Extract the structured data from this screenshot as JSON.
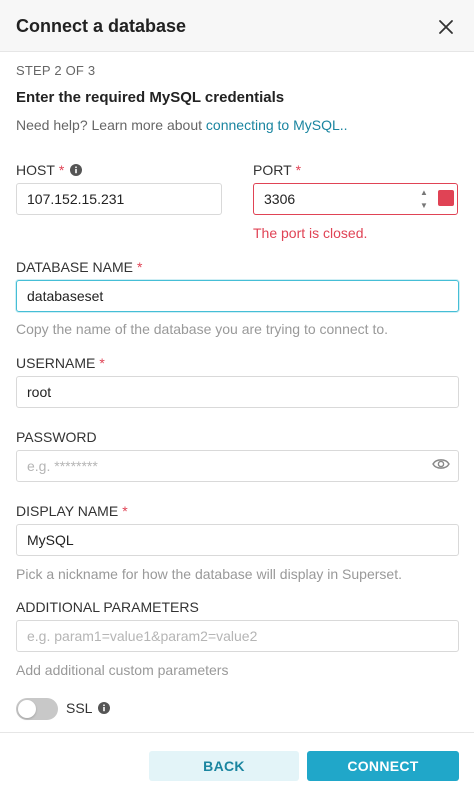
{
  "modal": {
    "title": "Connect a database",
    "step": "STEP 2 OF 3",
    "heading": "Enter the required MySQL credentials",
    "help_prefix": "Need help? Learn more about ",
    "help_link": "connecting to MySQL.."
  },
  "fields": {
    "host": {
      "label": "HOST",
      "required": "*",
      "value": "107.152.15.231"
    },
    "port": {
      "label": "PORT",
      "required": "*",
      "value": "3306",
      "error": "The port is closed."
    },
    "database_name": {
      "label": "DATABASE NAME",
      "required": "*",
      "value": "databaseset",
      "helper": "Copy the name of the database you are trying to connect to."
    },
    "username": {
      "label": "USERNAME",
      "required": "*",
      "value": "root"
    },
    "password": {
      "label": "PASSWORD",
      "placeholder": "e.g. ********"
    },
    "display_name": {
      "label": "DISPLAY NAME",
      "required": "*",
      "value": "MySQL",
      "helper": "Pick a nickname for how the database will display in Superset."
    },
    "additional_parameters": {
      "label": "ADDITIONAL PARAMETERS",
      "placeholder": "e.g. param1=value1&param2=value2",
      "helper": "Add additional custom parameters"
    }
  },
  "ssl": {
    "label": "SSL",
    "enabled": false
  },
  "footer": {
    "back_label": "BACK",
    "connect_label": "CONNECT"
  },
  "colors": {
    "accent": "#20a7c9",
    "error": "#e04355",
    "link": "#1a85a0"
  },
  "icons": {
    "close": "close-icon",
    "info": "info-icon",
    "eye": "eye-icon"
  }
}
